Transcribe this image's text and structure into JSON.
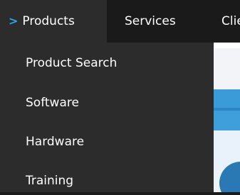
{
  "nav": {
    "items": [
      {
        "label": "Products",
        "active": true
      },
      {
        "label": "Services"
      },
      {
        "label": "Clie"
      }
    ],
    "active_indicator_icon": "chevron-right-icon",
    "colors": {
      "accent": "#2fa3e6",
      "active_bg": "#2c2c2c",
      "bar_bg": "#1a1a1a"
    }
  },
  "submenu": {
    "items": [
      {
        "label": "Product Search"
      },
      {
        "label": "Software"
      },
      {
        "label": "Hardware"
      },
      {
        "label": "Training"
      }
    ]
  }
}
